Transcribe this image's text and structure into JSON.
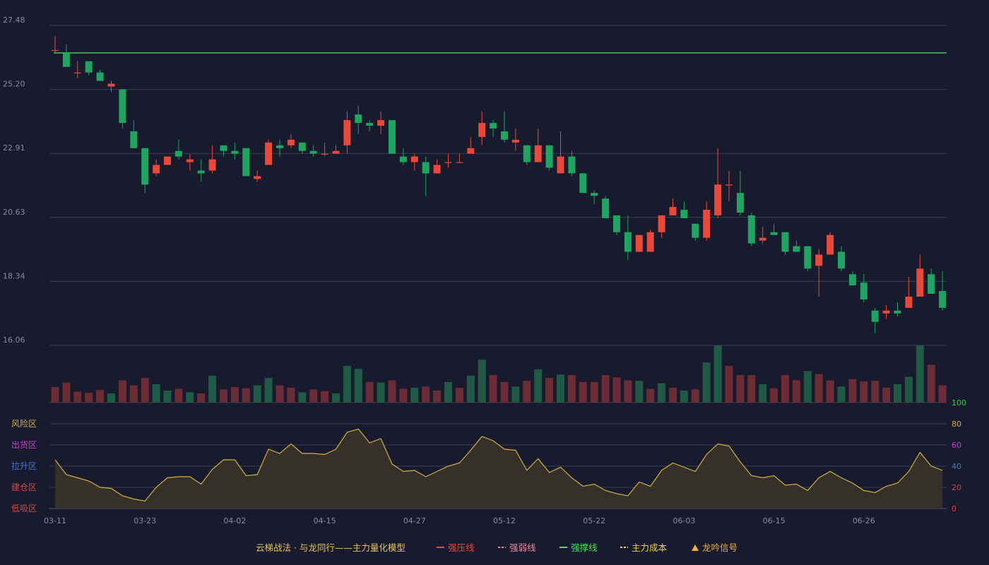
{
  "chart_data": {
    "type": "candlestick",
    "price_axis": {
      "ticks": [
        "27.48",
        "25.20",
        "22.91",
        "20.63",
        "18.34",
        "16.06"
      ],
      "ylim": [
        16.06,
        27.48
      ]
    },
    "x_labels": [
      "03-11",
      "03-23",
      "04-02",
      "04-15",
      "04-27",
      "05-12",
      "05-22",
      "06-03",
      "06-15",
      "06-26"
    ],
    "x_label_positions": [
      0,
      8,
      16,
      24,
      32,
      40,
      48,
      56,
      64,
      72
    ],
    "pressure_line_price": 26.5,
    "candles": [
      [
        26.6,
        26.6,
        27.1,
        26.5
      ],
      [
        26.5,
        26.0,
        26.8,
        26.0
      ],
      [
        25.8,
        25.8,
        26.2,
        25.6
      ],
      [
        26.2,
        25.8,
        26.2,
        25.7
      ],
      [
        25.8,
        25.5,
        25.9,
        25.5
      ],
      [
        25.3,
        25.4,
        25.5,
        25.1
      ],
      [
        25.2,
        24.0,
        25.2,
        23.8
      ],
      [
        23.7,
        23.1,
        24.1,
        23.1
      ],
      [
        23.1,
        21.8,
        23.1,
        21.5
      ],
      [
        22.2,
        22.5,
        22.7,
        22.1
      ],
      [
        22.5,
        22.8,
        22.8,
        22.5
      ],
      [
        23.0,
        22.8,
        23.4,
        22.7
      ],
      [
        22.6,
        22.7,
        22.9,
        22.3
      ],
      [
        22.3,
        22.2,
        22.7,
        21.9
      ],
      [
        22.3,
        22.7,
        23.2,
        22.2
      ],
      [
        23.2,
        23.0,
        23.2,
        22.8
      ],
      [
        23.0,
        22.9,
        23.3,
        22.7
      ],
      [
        23.1,
        22.1,
        23.1,
        22.1
      ],
      [
        22.0,
        22.1,
        22.3,
        21.9
      ],
      [
        22.5,
        23.3,
        23.4,
        22.5
      ],
      [
        23.2,
        23.1,
        23.4,
        22.8
      ],
      [
        23.2,
        23.4,
        23.6,
        23.1
      ],
      [
        23.3,
        23.0,
        23.3,
        22.9
      ],
      [
        23.0,
        22.9,
        23.2,
        22.8
      ],
      [
        22.9,
        22.9,
        23.3,
        22.8
      ],
      [
        22.9,
        23.0,
        23.2,
        22.9
      ],
      [
        23.2,
        24.1,
        24.4,
        22.9
      ],
      [
        24.3,
        24.0,
        24.6,
        23.6
      ],
      [
        24.0,
        23.9,
        24.1,
        23.7
      ],
      [
        23.9,
        24.1,
        24.4,
        23.6
      ],
      [
        24.1,
        22.9,
        24.1,
        22.9
      ],
      [
        22.8,
        22.6,
        23.1,
        22.5
      ],
      [
        22.6,
        22.8,
        22.9,
        22.3
      ],
      [
        22.6,
        22.2,
        22.8,
        21.4
      ],
      [
        22.2,
        22.5,
        22.7,
        22.2
      ],
      [
        22.6,
        22.6,
        22.9,
        22.4
      ],
      [
        22.6,
        22.6,
        22.9,
        22.6
      ],
      [
        22.9,
        23.1,
        23.5,
        22.9
      ],
      [
        23.5,
        24.0,
        24.4,
        23.2
      ],
      [
        24.0,
        23.8,
        24.1,
        23.5
      ],
      [
        23.7,
        23.4,
        24.4,
        23.3
      ],
      [
        23.3,
        23.4,
        23.8,
        23.0
      ],
      [
        23.2,
        22.6,
        23.2,
        22.5
      ],
      [
        22.6,
        23.2,
        23.8,
        22.6
      ],
      [
        23.2,
        22.4,
        23.2,
        22.3
      ],
      [
        22.2,
        22.8,
        23.7,
        22.2
      ],
      [
        22.8,
        22.2,
        23.0,
        22.1
      ],
      [
        22.2,
        21.5,
        22.2,
        21.5
      ],
      [
        21.5,
        21.4,
        21.6,
        21.1
      ],
      [
        21.3,
        20.6,
        21.4,
        20.6
      ],
      [
        20.7,
        20.1,
        20.7,
        20.0
      ],
      [
        20.1,
        19.4,
        20.7,
        19.1
      ],
      [
        19.4,
        20.0,
        20.0,
        19.4
      ],
      [
        19.4,
        20.1,
        20.2,
        19.4
      ],
      [
        20.1,
        20.7,
        20.7,
        19.9
      ],
      [
        20.7,
        21.0,
        21.3,
        20.7
      ],
      [
        20.9,
        20.6,
        21.2,
        20.6
      ],
      [
        20.4,
        19.9,
        20.4,
        19.8
      ],
      [
        19.9,
        20.9,
        21.2,
        19.8
      ],
      [
        20.7,
        21.8,
        23.1,
        20.6
      ],
      [
        21.8,
        21.8,
        22.3,
        21.2
      ],
      [
        21.5,
        20.8,
        22.3,
        20.7
      ],
      [
        20.7,
        19.7,
        20.8,
        19.6
      ],
      [
        19.8,
        19.9,
        20.3,
        19.7
      ],
      [
        20.1,
        20.0,
        20.4,
        20.0
      ],
      [
        20.1,
        19.4,
        20.1,
        19.3
      ],
      [
        19.6,
        19.4,
        19.8,
        19.4
      ],
      [
        19.6,
        18.8,
        19.6,
        18.7
      ],
      [
        18.9,
        19.3,
        19.5,
        17.8
      ],
      [
        19.3,
        20.0,
        20.1,
        19.3
      ],
      [
        19.4,
        18.8,
        19.6,
        18.7
      ],
      [
        18.6,
        18.2,
        18.7,
        18.2
      ],
      [
        18.3,
        17.7,
        18.6,
        17.6
      ],
      [
        17.3,
        16.9,
        17.4,
        16.5
      ],
      [
        17.2,
        17.3,
        17.5,
        17.0
      ],
      [
        17.3,
        17.2,
        17.6,
        17.1
      ],
      [
        17.4,
        17.8,
        18.5,
        17.4
      ],
      [
        17.8,
        18.8,
        19.3,
        17.8
      ],
      [
        18.6,
        17.9,
        18.8,
        17.9
      ],
      [
        18.0,
        17.4,
        18.7,
        17.3
      ]
    ],
    "volume": [
      27,
      35,
      19,
      17,
      22,
      16,
      39,
      30,
      43,
      32,
      21,
      24,
      18,
      16,
      47,
      23,
      27,
      25,
      30,
      43,
      30,
      26,
      18,
      23,
      20,
      16,
      64,
      59,
      36,
      35,
      39,
      24,
      26,
      28,
      21,
      36,
      26,
      47,
      75,
      48,
      36,
      28,
      38,
      58,
      43,
      49,
      48,
      36,
      36,
      48,
      44,
      39,
      38,
      24,
      34,
      26,
      21,
      23,
      70,
      100,
      64,
      48,
      48,
      32,
      25,
      48,
      39,
      55,
      50,
      39,
      28,
      41,
      37,
      38,
      26,
      32,
      45,
      100,
      66,
      30
    ],
    "volume_colors": [
      "r",
      "r",
      "r",
      "r",
      "r",
      "g",
      "r",
      "r",
      "r",
      "g",
      "g",
      "r",
      "g",
      "r",
      "g",
      "r",
      "r",
      "r",
      "g",
      "g",
      "r",
      "r",
      "g",
      "r",
      "r",
      "g",
      "g",
      "g",
      "r",
      "g",
      "r",
      "r",
      "g",
      "r",
      "r",
      "g",
      "r",
      "g",
      "g",
      "r",
      "r",
      "g",
      "r",
      "g",
      "r",
      "g",
      "r",
      "r",
      "r",
      "r",
      "r",
      "r",
      "g",
      "r",
      "g",
      "r",
      "g",
      "r",
      "g",
      "g",
      "r",
      "r",
      "r",
      "g",
      "r",
      "r",
      "r",
      "g",
      "r",
      "r",
      "g",
      "r",
      "r",
      "r",
      "r",
      "g",
      "g",
      "g",
      "r",
      "r"
    ],
    "oscillator": {
      "values": [
        46,
        32,
        29,
        26,
        20,
        19,
        12,
        9,
        7,
        20,
        29,
        30,
        30,
        23,
        37,
        46,
        46,
        31,
        32,
        56,
        52,
        61,
        52,
        52,
        51,
        56,
        72,
        75,
        62,
        66,
        42,
        35,
        36,
        30,
        35,
        40,
        43,
        55,
        68,
        64,
        56,
        55,
        36,
        47,
        34,
        39,
        29,
        21,
        23,
        17,
        14,
        12,
        25,
        21,
        36,
        43,
        39,
        35,
        51,
        61,
        59,
        44,
        31,
        29,
        31,
        22,
        23,
        17,
        29,
        35,
        29,
        24,
        17,
        15,
        21,
        24,
        35,
        53,
        40,
        36
      ],
      "ylim": [
        0,
        100
      ],
      "right_ticks": [
        "100",
        "80",
        "60",
        "40",
        "20",
        "0"
      ],
      "right_tick_colors": [
        "#3ec94c",
        "#d4b03c",
        "#cc3fd4",
        "#3f79d4",
        "#d44a3f",
        "#d44a3f"
      ],
      "zones": [
        {
          "label": "风险区",
          "color": "#d4b03c"
        },
        {
          "label": "出货区",
          "color": "#cc3fd4"
        },
        {
          "label": "拉升区",
          "color": "#3f79d4"
        },
        {
          "label": "建仓区",
          "color": "#d44a3f"
        },
        {
          "label": "低吸区",
          "color": "#d44a3f"
        }
      ]
    },
    "colors": {
      "up": "#e8493a",
      "down": "#1fa560",
      "vol_up": "#6b2c35",
      "vol_down": "#1e5a45",
      "line": "#d4b03c",
      "pressure": "#46c357"
    }
  },
  "legend": {
    "title": "云梯战法 · 与龙同行——主力量化模型",
    "items": [
      {
        "label": "强压线",
        "color": "#e8493a",
        "style": "solid"
      },
      {
        "label": "强弱线",
        "color": "#f08aa0",
        "style": "dashed"
      },
      {
        "label": "强撑线",
        "color": "#46e45a",
        "style": "solid"
      },
      {
        "label": "主力成本",
        "color": "#f0d24a",
        "style": "dashed"
      },
      {
        "label": "龙吟信号",
        "color": "#f0b43c",
        "style": "triangle"
      }
    ]
  }
}
